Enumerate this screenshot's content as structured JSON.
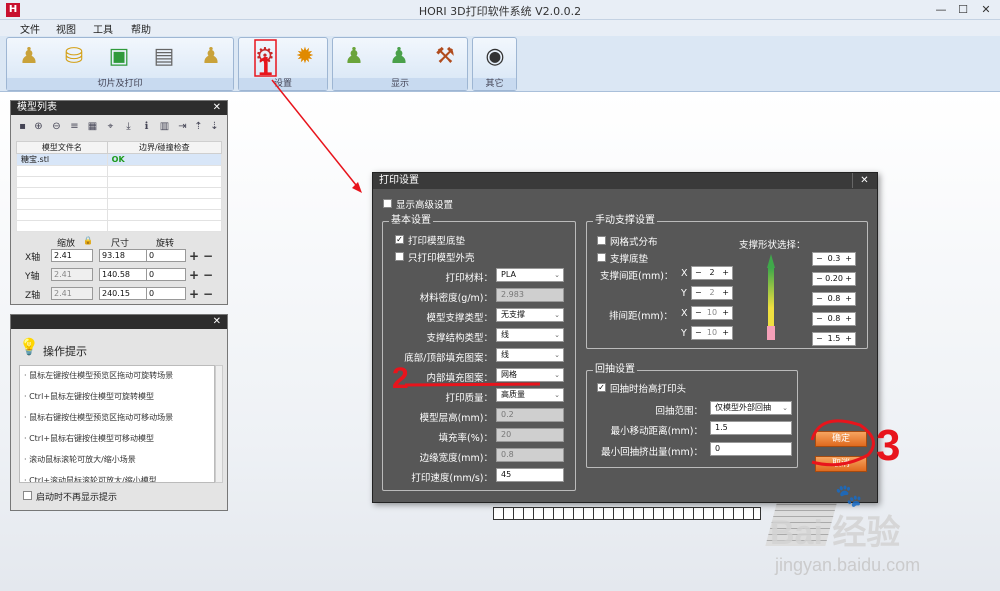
{
  "app": {
    "title": "HORI 3D打印软件系统 V2.0.0.2",
    "logo": "H",
    "min": "—",
    "max": "☐",
    "close": "✕"
  },
  "menu": [
    "文件",
    "视图",
    "工具",
    "帮助"
  ],
  "ribbon": {
    "groups": [
      {
        "label": "切片及打印",
        "icons": [
          "pawn-load-icon",
          "layers-icon",
          "export-icon",
          "print-icon",
          "pawn-icon"
        ]
      },
      {
        "label": "设置",
        "icons": [
          "print-settings-icon",
          "gear-icon"
        ]
      },
      {
        "label": "显示",
        "icons": [
          "pawn-display-icon",
          "pawn-view-icon",
          "tool-icon"
        ]
      },
      {
        "label": "其它",
        "icons": [
          "camera-icon"
        ]
      }
    ]
  },
  "model_list": {
    "title": "模型列表",
    "close": "✕",
    "col_name": "模型文件名",
    "col_check": "边界/碰撞检查",
    "rows": [
      {
        "name": "糖宝.stl",
        "check": "OK"
      }
    ],
    "hdr_scale": "缩放",
    "hdr_size": "尺寸",
    "hdr_rotate": "旋转",
    "axes": [
      {
        "label": "X轴",
        "scale": "2.41",
        "size": "93.18",
        "rotate": "0"
      },
      {
        "label": "Y轴",
        "scale": "2.41",
        "size": "140.58",
        "rotate": "0"
      },
      {
        "label": "Z轴",
        "scale": "2.41",
        "size": "240.15",
        "rotate": "0"
      }
    ],
    "plus": "+",
    "minus": "−"
  },
  "tips": {
    "title": "操作提示",
    "close": "✕",
    "items": [
      "· 鼠标左键按住模型预览区拖动可旋转场景",
      "· Ctrl+鼠标左键按住模型可旋转模型",
      "· 鼠标右键按住模型预览区拖动可移动场景",
      "· Ctrl+鼠标右键按住模型可移动模型",
      "· 滚动鼠标滚轮可放大/缩小场景",
      "· Ctrl+滚动鼠标滚轮可放大/缩小模型"
    ],
    "no_show": "启动时不再显示提示"
  },
  "dialog": {
    "title": "打印设置",
    "close": "✕",
    "show_advanced": "显示高级设置",
    "basic": {
      "title": "基本设置",
      "print_base": "打印模型底垫",
      "shell_only": "只打印模型外壳",
      "material_label": "打印材料：",
      "material": "PLA",
      "density_label": "材料密度(g/m)：",
      "density": "2.983",
      "support_type_label": "模型支撑类型：",
      "support_type": "无支撑",
      "support_struct_label": "支撑结构类型：",
      "support_struct": "线",
      "topbottom_label": "底部/顶部填充图案：",
      "topbottom": "线",
      "infill_pattern_label": "内部填充图案：",
      "infill_pattern": "网格",
      "quality_label": "打印质量：",
      "quality": "高质量",
      "layer_label": "模型层高(mm)：",
      "layer": "0.2",
      "fill_label": "填充率(%)：",
      "fill": "20",
      "wall_label": "边缘宽度(mm)：",
      "wall": "0.8",
      "speed_label": "打印速度(mm/s)：",
      "speed": "45"
    },
    "manual": {
      "title": "手动支撑设置",
      "grid": "网格式分布",
      "base": "支撑底垫",
      "spacing_label": "支撑间距(mm)：",
      "row_label": "排间距(mm)：",
      "x": "X",
      "y": "Y",
      "sx": "2",
      "sy": "2",
      "rx": "10",
      "ry": "10",
      "shape_label": "支撑形状选择：",
      "shapes": [
        "0.3",
        "0.20",
        "0.8",
        "0.8",
        "1.5"
      ]
    },
    "retract": {
      "title": "回抽设置",
      "lift": "回抽时抬高打印头",
      "range_label": "回抽范围：",
      "range": "仅模型外部回抽",
      "min_move_label": "最小移动距离(mm)：",
      "min_move": "1.5",
      "min_extrude_label": "最小回抽挤出量(mm)：",
      "min_extrude": "0"
    },
    "ok": "确定",
    "cancel": "取消"
  },
  "annotations": [
    "1",
    "2",
    "3"
  ],
  "watermark": {
    "brand": "Bai  经验",
    "url": "jingyan.baidu.com"
  },
  "colors": {
    "accent": "#e06a1e",
    "annotation": "#e8141c",
    "dialog": "#575757"
  }
}
